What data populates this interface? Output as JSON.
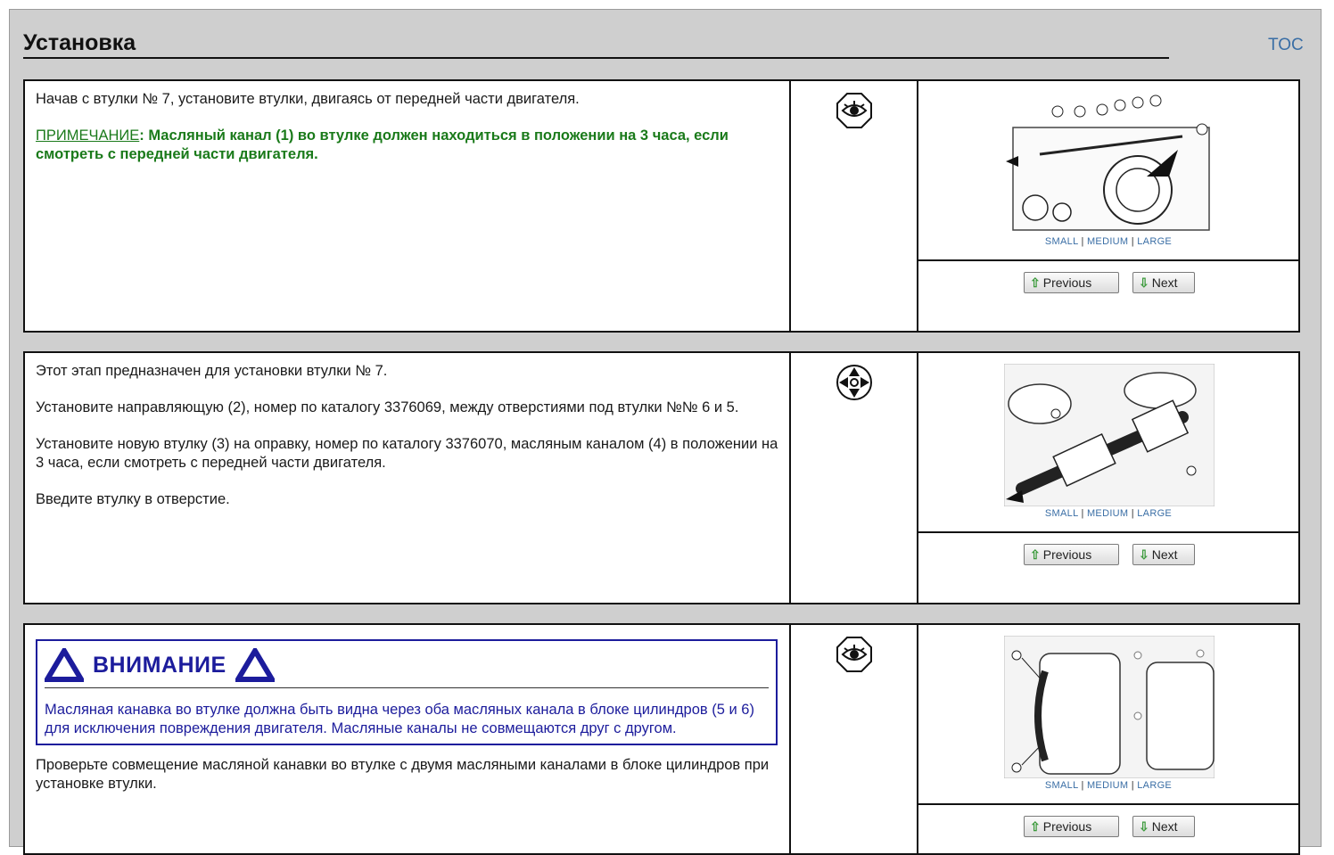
{
  "header": {
    "title": "Установка",
    "toc_link": "TOC"
  },
  "steps": [
    {
      "paragraphs": [
        "Начав с втулки № 7, установите втулки, двигаясь от передней части двигателя."
      ],
      "note_label": "ПРИМЕЧАНИЕ",
      "note_text": ": Масляный канал (1) во втулке должен находиться в положении на 3 часа, если смотреть с передней части двигателя.",
      "icon": "eye-icon",
      "image_size_links": [
        "SMALL",
        "MEDIUM",
        "LARGE"
      ],
      "prev_label": "Previous",
      "next_label": "Next"
    },
    {
      "paragraphs": [
        "Этот этап предназначен для установки втулки № 7.",
        "Установите направляющую (2), номер по каталогу 3376069, между отверстиями под втулки №№ 6 и 5.",
        "Установите новую втулку (3) на оправку, номер по каталогу 3376070, масляным каналом (4) в положении на 3 часа, если смотреть с передней части двигателя.",
        "Введите втулку в отверстие."
      ],
      "icon": "tools-icon",
      "image_size_links": [
        "SMALL",
        "MEDIUM",
        "LARGE"
      ],
      "prev_label": "Previous",
      "next_label": "Next"
    },
    {
      "warning_title": "ВНИМАНИЕ",
      "warning_text": "Масляная канавка во втулке должна быть видна через оба масляных канала в блоке цилиндров (5 и 6) для исключения повреждения двигателя. Масляные каналы не совмещаются друг с другом.",
      "paragraphs": [
        "Проверьте совмещение масляной канавки во втулке с двумя масляными каналами в блоке цилиндров при установке втулки."
      ],
      "icon": "eye-icon",
      "image_size_links": [
        "SMALL",
        "MEDIUM",
        "LARGE"
      ],
      "prev_label": "Previous",
      "next_label": "Next"
    }
  ]
}
